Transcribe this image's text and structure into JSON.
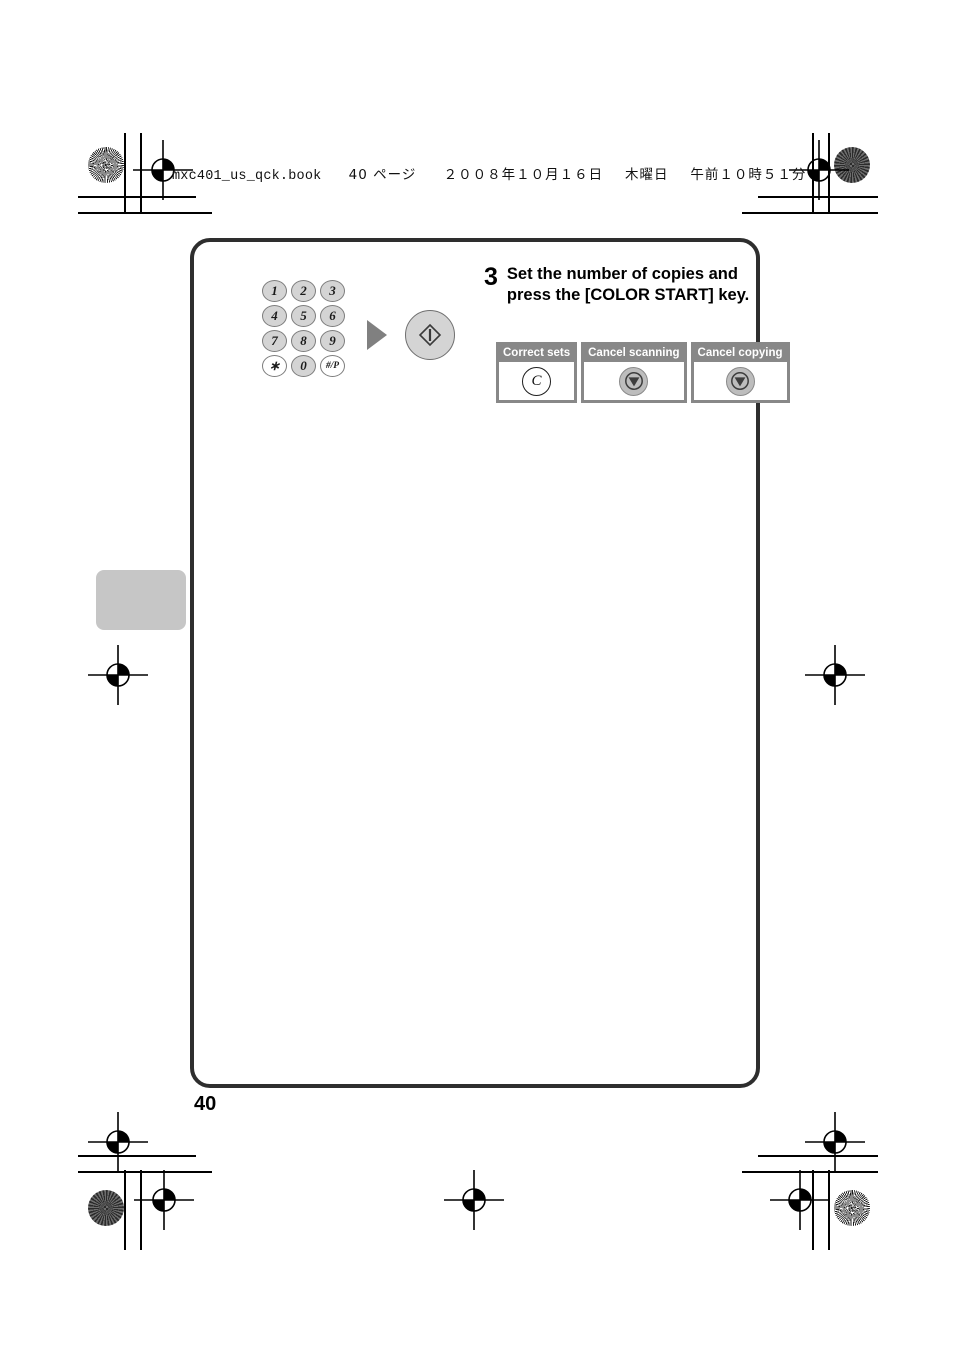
{
  "document": {
    "header_imprint": {
      "filename": "mxc401_us_qck.book",
      "page_label": "40 ページ",
      "date": "２００８年１０月１６日",
      "weekday": "木曜日",
      "time": "午前１０時５１分"
    },
    "page_number": "40"
  },
  "step": {
    "number": "3",
    "text": "Set the number of copies and press the [COLOR START] key."
  },
  "keypad": {
    "keys": [
      {
        "label": "1",
        "style": "filled"
      },
      {
        "label": "2",
        "style": "filled"
      },
      {
        "label": "3",
        "style": "filled"
      },
      {
        "label": "4",
        "style": "filled"
      },
      {
        "label": "5",
        "style": "filled"
      },
      {
        "label": "6",
        "style": "filled"
      },
      {
        "label": "7",
        "style": "filled"
      },
      {
        "label": "8",
        "style": "filled"
      },
      {
        "label": "9",
        "style": "filled"
      },
      {
        "label": "∗",
        "style": "hollow"
      },
      {
        "label": "0",
        "style": "filled"
      },
      {
        "label": "#/P",
        "style": "hollow small"
      }
    ]
  },
  "start_button": {
    "icon": "color-start-icon"
  },
  "arrow": {
    "icon": "right-arrow-icon"
  },
  "callouts": [
    {
      "title": "Correct sets",
      "icon": "clear-c-key-icon"
    },
    {
      "title": "Cancel scanning",
      "icon": "stop-key-icon"
    },
    {
      "title": "Cancel copying",
      "icon": "stop-key-icon"
    }
  ],
  "colors": {
    "frame_border": "#2e2e2e",
    "callout_border": "#888888",
    "callout_title_bg": "#888888",
    "key_fill": "#d4d4d4",
    "tab_fill": "#c6c6c6",
    "arrow_fill": "#808080"
  }
}
